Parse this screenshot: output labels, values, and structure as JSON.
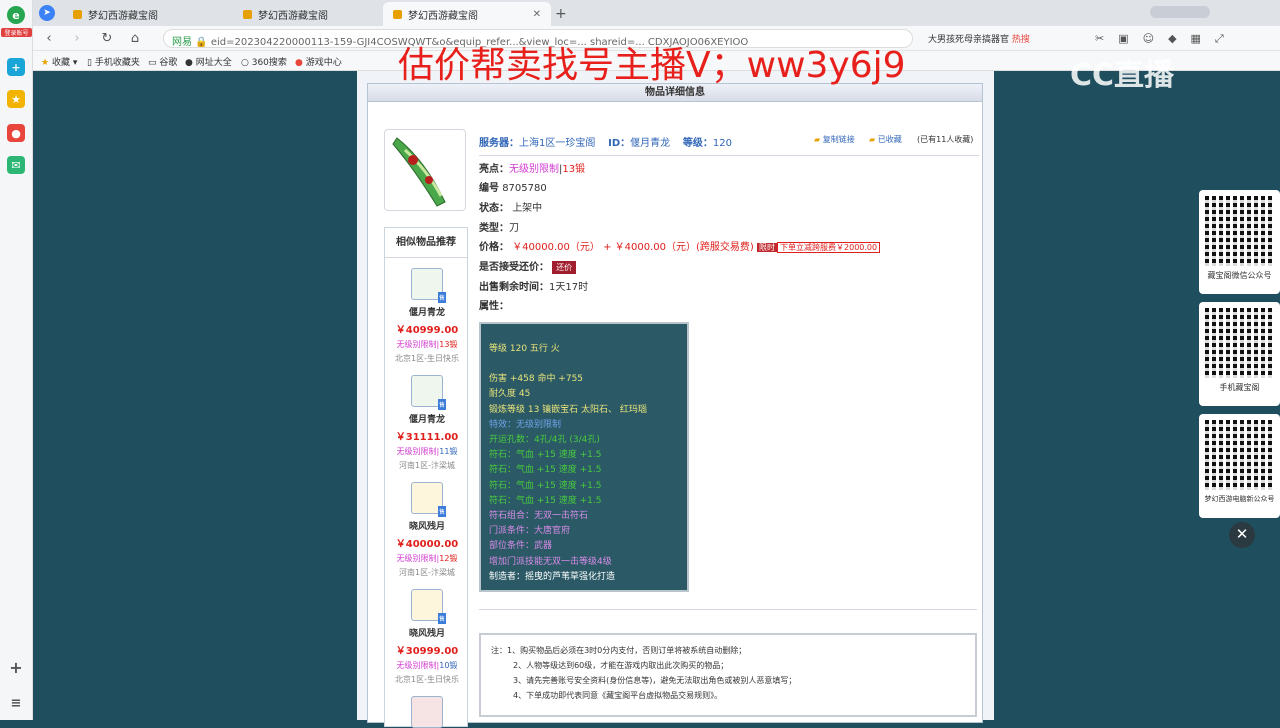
{
  "sidebar": {
    "login_label": "登录账号",
    "icons": [
      "browser-logo-icon",
      "add-icon",
      "star-icon",
      "weibo-icon",
      "mail-icon",
      "plus-icon",
      "menu-icon"
    ]
  },
  "tabs": [
    {
      "label": "梦幻西游藏宝阁",
      "active": false
    },
    {
      "label": "梦幻西游藏宝阁",
      "active": false
    },
    {
      "label": "梦幻西游藏宝阁",
      "active": true
    }
  ],
  "address": {
    "prefix": "网易",
    "url": "eid=202304220000113-159-GJI4COSWQWT&o&equip_refer...&view_loc=... shareid=... CDXJAOJO06XEYIOO"
  },
  "toolbar_right": {
    "search_text": "大男孩死母亲搞器官",
    "hot_label": "热搜"
  },
  "bookmarks": [
    "收藏",
    "手机收藏夹",
    "谷歌",
    "网址大全",
    "360搜索",
    "游戏中心"
  ],
  "overlay": {
    "text": "估价帮卖找号主播V；ww3y6j9",
    "watermark": "CC直播"
  },
  "detail": {
    "header": "物品详细信息",
    "server_label": "服务器：",
    "server_value": "上海1区一珍宝阁",
    "id_label": "ID：",
    "id_value": "偃月青龙",
    "level_label": "等级：",
    "level_value": "120",
    "copy_link": "复制链接",
    "favorited": "已收藏",
    "fav_count": "(已有11人收藏)",
    "highlight_label": "亮点：",
    "highlight_value": "无级别限制",
    "highlight_extra": "13锻",
    "serial_label": "编号",
    "serial_value": "8705780",
    "status_label": "状态：",
    "status_value": "上架中",
    "type_label": "类型：",
    "type_value": "刀",
    "price_label": "价格：",
    "price_value": "￥40000.00（元）",
    "price_plus": "+",
    "price_fee": "￥4000.00（元）(跨服交易费)",
    "limit_tag": "限时",
    "limit_text": "下单立减跨服费￥2000.00",
    "bargain_label": "是否接受还价：",
    "bargain_btn": "还价",
    "remaining_label": "出售剩余时间：",
    "remaining_value": "1天17时",
    "attr_label": "属性："
  },
  "similar": {
    "title": "相似物品推荐",
    "items": [
      {
        "name": "偃月青龙",
        "price": "￥40999.00",
        "limit": "无级别限制",
        "forge": "13锻",
        "server": "北京1区-生日快乐"
      },
      {
        "name": "偃月青龙",
        "price": "￥31111.00",
        "limit": "无级别限制",
        "forge": "11锻",
        "server": "河南1区-汴梁城"
      },
      {
        "name": "晓风残月",
        "price": "￥40000.00",
        "limit": "无级别限制",
        "forge": "12锻",
        "server": "河南1区-汴梁城"
      },
      {
        "name": "晓风残月",
        "price": "￥30999.00",
        "limit": "无级别限制",
        "forge": "10锻",
        "server": "北京1区-生日快乐"
      }
    ],
    "sale_badge": "售"
  },
  "attributes": [
    {
      "text": "等级 120 五行 火",
      "color": "#e8e37a"
    },
    {
      "text": "",
      "color": "#e8e37a"
    },
    {
      "text": "伤害 +458 命中 +755",
      "color": "#e8e37a"
    },
    {
      "text": "耐久度 45",
      "color": "#e8e37a"
    },
    {
      "text": "锻炼等级 13 镶嵌宝石 太阳石、 红玛瑙",
      "color": "#e8e37a"
    },
    {
      "text": "特效：无级别限制",
      "color": "#6ea3e8"
    },
    {
      "text": "开运孔数：4孔/4孔  (3/4孔)",
      "color": "#49c93e"
    },
    {
      "text": "符石：气血 +15 速度 +1.5",
      "color": "#49c93e"
    },
    {
      "text": "符石：气血 +15 速度 +1.5",
      "color": "#49c93e"
    },
    {
      "text": "符石：气血 +15 速度 +1.5",
      "color": "#49c93e"
    },
    {
      "text": "符石：气血 +15 速度 +1.5",
      "color": "#49c93e"
    },
    {
      "text": "符石组合：无双一击符石",
      "color": "#d88be8"
    },
    {
      "text": "门派条件：大唐官府",
      "color": "#d88be8"
    },
    {
      "text": "部位条件：武器",
      "color": "#d88be8"
    },
    {
      "text": "增加门派技能无双一击等级4级",
      "color": "#d88be8"
    },
    {
      "text": "制造者：摇曳的芦苇草强化打造",
      "color": "#ffffff"
    }
  ],
  "notes": {
    "prefix": "注：",
    "items": [
      "1、购买物品后必须在3时0分内支付，否则订单将被系统自动删除；",
      "2、人物等级达到60级，才能在游戏内取出此次购买的物品；",
      "3、请先完善账号安全资料(身份信息等)，避免无法取出角色或被别人恶意填写；",
      "4、下单成功即代表同意《藏宝阁平台虚拟物品交易规则》。"
    ]
  },
  "qrcodes": [
    {
      "caption": "藏宝阁微信公众号"
    },
    {
      "caption": "手机藏宝阁"
    },
    {
      "caption": "梦幻西游电脑新公众号"
    }
  ],
  "close_symbol": "✕"
}
